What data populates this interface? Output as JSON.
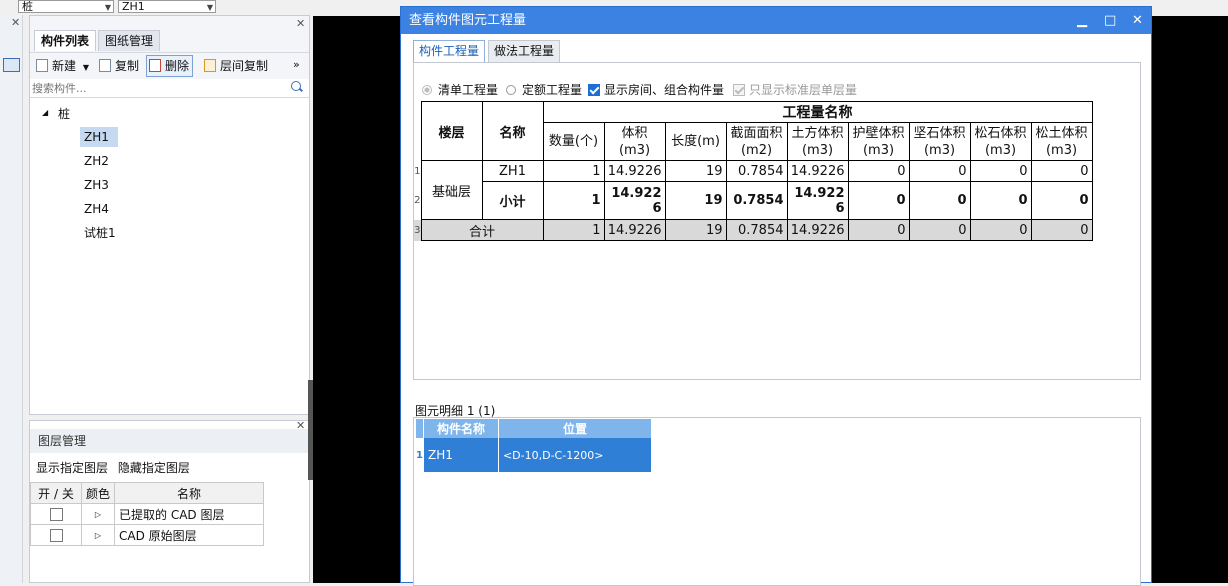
{
  "top_bar": {
    "combo1": "桩",
    "combo2": "ZH1"
  },
  "component_panel": {
    "tabs": [
      "构件列表",
      "图纸管理"
    ],
    "toolbar": {
      "new": "新建",
      "copy": "复制",
      "delete": "删除",
      "floor_copy": "层间复制"
    },
    "search_placeholder": "搜索构件...",
    "tree_root": "桩",
    "items": [
      "ZH1",
      "ZH2",
      "ZH3",
      "ZH4",
      "试桩1"
    ]
  },
  "layer_panel": {
    "title": "图层管理",
    "show_link": "显示指定图层",
    "hide_link": "隐藏指定图层",
    "headers": [
      "开 / 关",
      "颜色",
      "名称"
    ],
    "rows": [
      "已提取的 CAD 图层",
      "CAD 原始图层"
    ]
  },
  "dialog": {
    "title": "查看构件图元工程量",
    "tabs": [
      "构件工程量",
      "做法工程量"
    ],
    "options": {
      "list_qty": "清单工程量",
      "quota_qty": "定额工程量",
      "show_room": "显示房间、组合构件量",
      "std_floor": "只显示标准层单层量"
    },
    "table": {
      "col_floor": "楼层",
      "col_name": "名称",
      "group_header": "工程量名称",
      "headers": [
        "数量(个)",
        "体积(m3)",
        "长度(m)",
        "截面面积(m2)",
        "土方体积(m3)",
        "护壁体积(m3)",
        "坚石体积(m3)",
        "松石体积(m3)",
        "松土体积(m3)"
      ],
      "floor": "基础层",
      "rows": [
        {
          "num": "1",
          "name": "ZH1",
          "values": [
            "1",
            "14.9226",
            "19",
            "0.7854",
            "14.9226",
            "0",
            "0",
            "0",
            "0"
          ]
        },
        {
          "num": "2",
          "name": "小计",
          "values": [
            "1",
            "14.9226",
            "19",
            "0.7854",
            "14.9226",
            "0",
            "0",
            "0",
            "0"
          ]
        }
      ],
      "total": {
        "num": "3",
        "label": "合计",
        "values": [
          "1",
          "14.9226",
          "19",
          "0.7854",
          "14.9226",
          "0",
          "0",
          "0",
          "0"
        ]
      }
    },
    "detail": {
      "label": "图元明细  1 (1)",
      "headers": [
        "构件名称",
        "位置"
      ],
      "row": {
        "num": "1",
        "name": "ZH1",
        "position": "<D-10,D-C-1200>"
      }
    }
  }
}
